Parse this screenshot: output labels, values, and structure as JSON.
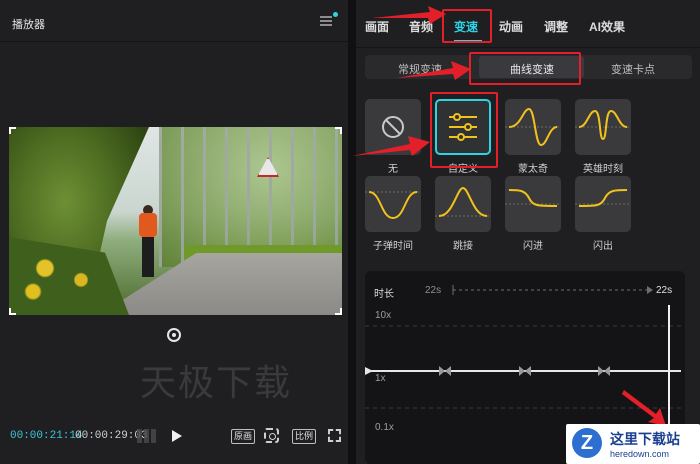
{
  "player": {
    "title": "播放器",
    "current_time": "00:00:21:14",
    "total_time": "00:00:29:03",
    "buttons": {
      "original": "原画",
      "ratio": "比例"
    },
    "watermark": "天极下载"
  },
  "tabs": {
    "items": [
      "画面",
      "音频",
      "变速",
      "动画",
      "调整",
      "AI效果"
    ],
    "active": "变速"
  },
  "subtabs": {
    "items": [
      "常规变速",
      "曲线变速",
      "变速卡点"
    ],
    "active": "曲线变速"
  },
  "presets": [
    {
      "label": "无",
      "icon": "none-icon"
    },
    {
      "label": "自定义",
      "icon": "custom-sliders-icon",
      "selected": true
    },
    {
      "label": "蒙太奇",
      "icon": "montage-curve-icon"
    },
    {
      "label": "英雄时刻",
      "icon": "hero-moment-curve-icon"
    },
    {
      "label": "子弹时间",
      "icon": "bullet-time-curve-icon"
    },
    {
      "label": "跳接",
      "icon": "jump-cut-curve-icon"
    },
    {
      "label": "闪进",
      "icon": "flash-in-curve-icon"
    },
    {
      "label": "闪出",
      "icon": "flash-out-curve-icon"
    }
  ],
  "curve_editor": {
    "duration_label": "时长",
    "duration_start": "22s",
    "duration_end": "22s",
    "y_labels": [
      "10x",
      "1x",
      "0.1x"
    ]
  },
  "brand": {
    "name": "这里下载站",
    "url": "heredown.com"
  },
  "colors": {
    "accent": "#2ed3e6",
    "annotation_red": "#e3202a",
    "curve_yellow": "#f1c21b"
  }
}
